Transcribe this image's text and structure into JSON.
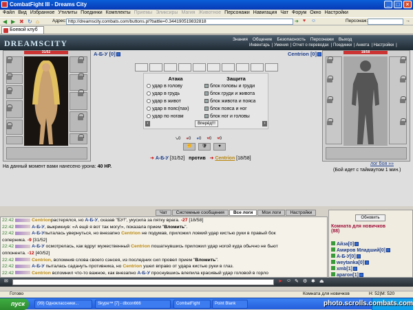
{
  "window": {
    "title": "CombatFight III - Dreams City"
  },
  "menu": [
    "Файл",
    "Вид",
    "Избранное",
    "Утилиты",
    "Поединки",
    "Комплекты",
    "Приемы",
    "Эликсиры",
    "Магия",
    "Животное",
    "Персонажи",
    "Навигация",
    "Чат",
    "Форум",
    "Окно",
    "Настройки"
  ],
  "menu_dim": [
    "Приемы",
    "Эликсиры",
    "Магия",
    "Животное"
  ],
  "address": {
    "label": "Адрес:",
    "value": "http://dreamscity.combats.com/buttons.pl?battle=0.344190519832818",
    "search_label": "Персонаж:"
  },
  "tab": {
    "label": "Боевой клуб"
  },
  "site": {
    "logo": "DREAMSCITY",
    "nav_top": [
      "Знания",
      "Общение",
      "Безопасность",
      "Персонажи",
      "Выход"
    ],
    "nav_bottom": [
      "Инвентарь",
      "Умения",
      "Отчет о переводах",
      "Поединки",
      "Анкета",
      "Настройки"
    ]
  },
  "player": {
    "name": "А-Б-У",
    "level": "[0]",
    "hp": "31/52"
  },
  "enemy": {
    "name": "Centrion",
    "level": "[0]",
    "hp": "18/58"
  },
  "combat": {
    "attack_title": "Атака",
    "defense_title": "Защита",
    "attacks": [
      "удар в голову",
      "удар в грудь",
      "удар в живот",
      "удар в пояс(пах)",
      "удар по ногам"
    ],
    "blocks": [
      "блок головы и груди",
      "блок груди и живота",
      "блок живота и пояса",
      "блок пояса и ног",
      "блок ног и головы"
    ],
    "go_button": "Вперёд!!!",
    "counters": [
      "0",
      "0",
      "0",
      "0",
      "0"
    ]
  },
  "damage": {
    "prefix": "На данный момент вами нанесено урона:",
    "value": "40 HP."
  },
  "versus": {
    "p1": "А-Б-У",
    "p1hp": "[31/52]",
    "mid": "против",
    "p2": "Centrion",
    "p2hp": "[18/58]"
  },
  "battle_log": {
    "link": "лог боя »»",
    "timeout": "(Бой идет с таймаутом 1 мин.)"
  },
  "chat_tabs": [
    "Чат",
    "Системные сообщения",
    "Все логи",
    "Мои логи",
    "Настройки"
  ],
  "chat": [
    {
      "t": "22:42",
      "parts": [
        [
          "nm2",
          "Centrion"
        ],
        [
          "",
          "растерялся, но "
        ],
        [
          "nm",
          "А-Б-У"
        ],
        [
          "",
          ", сказав \"БУ!\", укусила за пятку врага. "
        ],
        [
          "dmg",
          "-27"
        ],
        [
          "",
          " [18/58]"
        ]
      ]
    },
    {
      "t": "22:42",
      "parts": [
        [
          "nm",
          "А-Б-У"
        ],
        [
          "",
          ", выкрикнув: «А ещё я вот так могу!», показала прием \""
        ],
        [
          "q",
          "Вломить"
        ],
        [
          "",
          "\"."
        ]
      ]
    },
    {
      "t": "22:42",
      "parts": [
        [
          "nm",
          "А-Б-У"
        ],
        [
          "",
          "пыталась увернуться, но внезапно "
        ],
        [
          "nm2",
          "Centrion"
        ],
        [
          "",
          " не подумав, приложил ловкий удар кистью руки в правый бок"
        ]
      ]
    },
    {
      "t": "",
      "parts": [
        [
          "",
          "соперника. "
        ],
        [
          "dmg",
          "-9"
        ],
        [
          "",
          " [31/52]"
        ]
      ]
    },
    {
      "t": "22:42",
      "parts": [
        [
          "nm",
          "А-Б-У"
        ],
        [
          "",
          " осмотрелась, как вдруг мужественный "
        ],
        [
          "nm2",
          "Centrion"
        ],
        [
          "",
          " пошатнувшись приложил удар ногой куда обычно не бьют"
        ]
      ]
    },
    {
      "t": "",
      "parts": [
        [
          "",
          "оппонента. "
        ],
        [
          "dmg",
          "-12"
        ],
        [
          "",
          " [40/52]"
        ]
      ]
    },
    {
      "t": "22:42",
      "parts": [
        [
          "nm2",
          "Centrion"
        ],
        [
          "",
          ", вспомнив слова своего сэнсея, из последних сил провел прием \""
        ],
        [
          "q",
          "Вломить"
        ],
        [
          "",
          "\"."
        ]
      ]
    },
    {
      "t": "22:42",
      "parts": [
        [
          "nm",
          "А-Б-У"
        ],
        [
          "",
          " пыталась садануть противника, но "
        ],
        [
          "nm2",
          "Centrion"
        ],
        [
          "",
          " ушел вправо от удара кистью руки в глаз."
        ]
      ]
    },
    {
      "t": "22:42",
      "parts": [
        [
          "nm2",
          "Centrion"
        ],
        [
          "",
          " вспомнил что-то важное, как внезапно "
        ],
        [
          "nm",
          "А-Б-У"
        ],
        [
          "",
          " проснувшись влепила красивый удар головой в горло"
        ]
      ]
    },
    {
      "t": "",
      "parts": [
        [
          "",
          "противника. "
        ],
        [
          "dmg",
          "-13"
        ],
        [
          "",
          " [45/58]"
        ]
      ]
    }
  ],
  "room": {
    "refresh": "Обновить",
    "title": "Комната для новичков",
    "count": "(88)",
    "users": [
      "Айза[0]",
      "Амиров Младший[0]",
      "А-Б-У[0]",
      "weytanka[0]",
      "xmb[1]",
      "арагон[1]"
    ]
  },
  "status": {
    "left": "Готово",
    "room": "Комната для новичков",
    "stats": "H: 52|M: 520"
  },
  "taskbar": {
    "start": "пуск",
    "items": [
      "(99) Одноклассники...",
      "Skype™ [7] - dbcon666",
      "CombatFight",
      "Point Blank"
    ]
  },
  "watermark": "photo.scrolls.combats.com"
}
